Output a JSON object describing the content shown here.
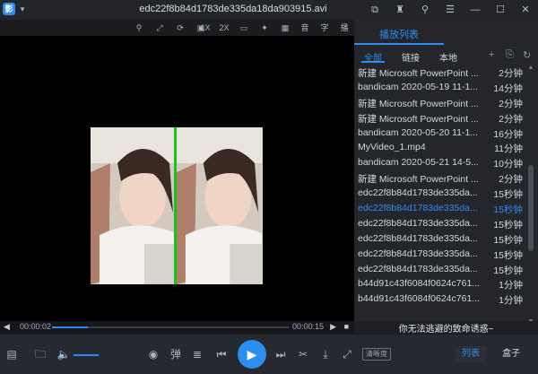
{
  "window": {
    "title": "edc22f8b84d1783de335da18da903915.avi",
    "logo_glyph": "影",
    "controls": [
      "box-icon",
      "shirt-icon",
      "pin-icon",
      "menu-icon",
      "minimize-icon",
      "maximize-icon",
      "close-icon"
    ]
  },
  "video_toolbar": {
    "speed_1x": "1X",
    "speed_2x": "2X",
    "audio_label": "音",
    "subtitle_label": "字",
    "broadcast_label": "播"
  },
  "playback": {
    "current_time": "00:00:02",
    "total_time": "00:00:15",
    "progress": 0.15,
    "volume": 1.0
  },
  "playlist": {
    "title": "播放列表",
    "tabs": [
      "全部",
      "链接",
      "本地"
    ],
    "active_tab": 0,
    "items": [
      {
        "name": "新建 Microsoft PowerPoint ...",
        "duration": "2分钟"
      },
      {
        "name": "bandicam 2020-05-19 11-1...",
        "duration": "14分钟"
      },
      {
        "name": "新建 Microsoft PowerPoint ...",
        "duration": "2分钟"
      },
      {
        "name": "新建 Microsoft PowerPoint ...",
        "duration": "2分钟"
      },
      {
        "name": "bandicam 2020-05-20 11-1...",
        "duration": "16分钟"
      },
      {
        "name": "MyVideo_1.mp4",
        "duration": "11分钟"
      },
      {
        "name": "bandicam 2020-05-21 14-5...",
        "duration": "10分钟"
      },
      {
        "name": "新建 Microsoft PowerPoint ...",
        "duration": "2分钟"
      },
      {
        "name": "edc22f8b84d1783de335da...",
        "duration": "15秒钟"
      },
      {
        "name": "edc22f8b84d1783de335da...",
        "duration": "15秒钟",
        "active": true
      },
      {
        "name": "edc22f8b84d1783de335da...",
        "duration": "15秒钟"
      },
      {
        "name": "edc22f8b84d1783de335da...",
        "duration": "15秒钟"
      },
      {
        "name": "edc22f8b84d1783de335da...",
        "duration": "15秒钟"
      },
      {
        "name": "edc22f8b84d1783de335da...",
        "duration": "15秒钟"
      },
      {
        "name": "b44d91c43f6084f0624c761...",
        "duration": "1分钟"
      },
      {
        "name": "b44d91c43f6084f0624c761...",
        "duration": "1分钟"
      }
    ],
    "subtitle_text": "你无法逃避的致命诱惑~"
  },
  "bottom_bar": {
    "danmaku_label": "弹",
    "quality_label": "清晰度",
    "list_button": "列表",
    "box_button": "盒子"
  },
  "colors": {
    "accent": "#2d8cf0",
    "split_line": "#17c41f"
  }
}
